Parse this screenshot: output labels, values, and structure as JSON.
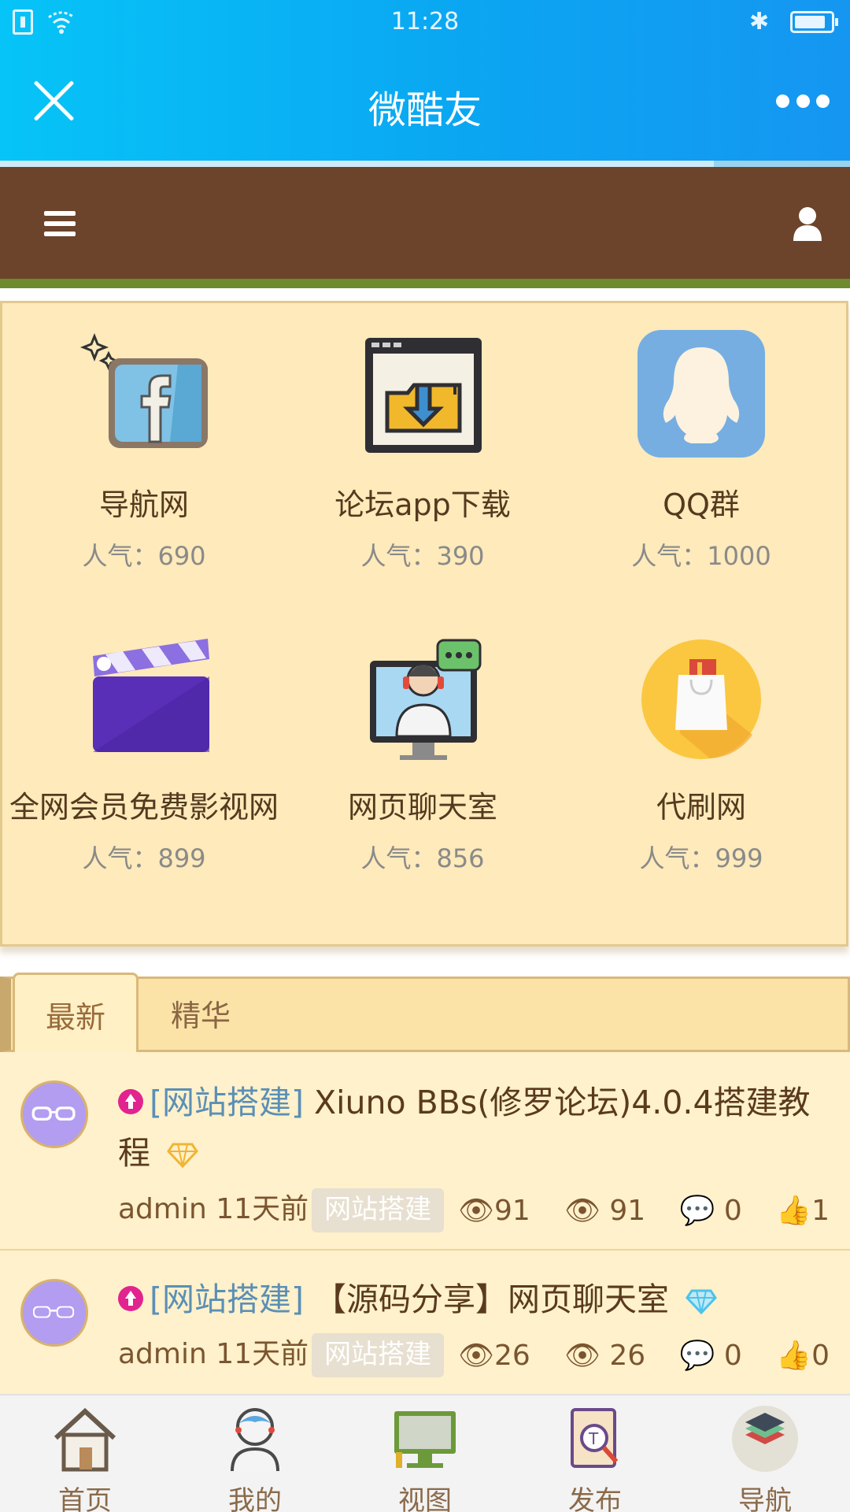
{
  "status_bar": {
    "time": "11:28"
  },
  "title_bar": {
    "title": "微酷友"
  },
  "page_load_progress": 0.84,
  "icon_grid": [
    {
      "name": "导航网",
      "popularity": "人气：690",
      "icon": "facebook-icon"
    },
    {
      "name": "论坛app下载",
      "popularity": "人气：390",
      "icon": "download-window-icon"
    },
    {
      "name": "QQ群",
      "popularity": "人气：1000",
      "icon": "qq-penguin-icon"
    },
    {
      "name": "全网会员免费影视网",
      "popularity": "人气：899",
      "icon": "clapperboard-icon"
    },
    {
      "name": "网页聊天室",
      "popularity": "人气：856",
      "icon": "chat-support-icon"
    },
    {
      "name": "代刷网",
      "popularity": "人气：999",
      "icon": "shopping-bag-icon"
    }
  ],
  "tabs": [
    {
      "label": "最新"
    },
    {
      "label": "精华"
    }
  ],
  "posts": [
    {
      "category": "[网站搭建]",
      "title": " Xiuno BBs(修罗论坛)4.0.4搭建教程",
      "author": "admin",
      "time": "11天前",
      "tag": "网站搭建",
      "views_a": "91",
      "views_b": "91",
      "comments": "0",
      "likes": "1",
      "badge": "gold-diamond-icon"
    },
    {
      "category": "[网站搭建]",
      "title": " 【源码分享】网页聊天室",
      "author": "admin",
      "time": "11天前",
      "tag": "网站搭建",
      "views_a": "26",
      "views_b": "26",
      "comments": "0",
      "likes": "0",
      "badge": "blue-diamond-icon"
    }
  ],
  "bottom_nav": [
    {
      "label": "首页",
      "icon": "home-icon"
    },
    {
      "label": "我的",
      "icon": "profile-icon"
    },
    {
      "label": "视图",
      "icon": "monitor-icon"
    },
    {
      "label": "发布",
      "icon": "publish-icon"
    },
    {
      "label": "导航",
      "icon": "layers-icon"
    }
  ],
  "colors": {
    "title_bar": "#0ba6f2",
    "forum_header": "#6b442b",
    "panel_bg": "#feeaba",
    "category_link": "#5b8fb5"
  }
}
